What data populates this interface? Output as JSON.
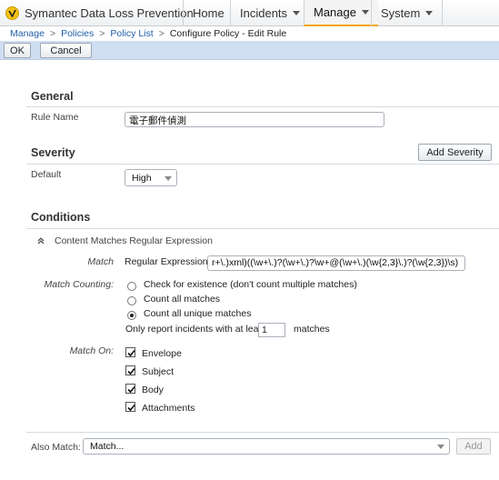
{
  "app": {
    "title": "Symantec Data Loss Prevention"
  },
  "nav": {
    "home": "Home",
    "incidents": "Incidents",
    "manage": "Manage",
    "system": "System"
  },
  "breadcrumb": {
    "manage": "Manage",
    "policies": "Policies",
    "policy_list": "Policy List",
    "current": "Configure Policy - Edit Rule",
    "separator": ">"
  },
  "toolbar": {
    "ok_label": "OK",
    "cancel_label": "Cancel"
  },
  "general": {
    "title": "General",
    "rule_name_label": "Rule Name",
    "rule_name_value": "電子郵件偵測"
  },
  "severity": {
    "title": "Severity",
    "add_severity_label": "Add Severity",
    "default_label": "Default",
    "default_value": "High"
  },
  "conditions": {
    "title": "Conditions",
    "condition_name": "Content Matches Regular Expression",
    "match_label": "Match",
    "regex_label": "Regular Expression:",
    "regex_value": "r+\\.)xml)((\\w+\\.)?(\\w+\\.)?\\w+@(\\w+\\.)(\\w{2,3}\\.)?(\\w{2,3})\\s)",
    "match_counting_label": "Match Counting:",
    "options": [
      {
        "label": "Check for existence (don't count multiple matches)",
        "selected": false
      },
      {
        "label": "Count all matches",
        "selected": false
      },
      {
        "label": "Count all unique matches",
        "selected": true
      }
    ],
    "report_prefix": "Only report incidents with at least",
    "report_value": "1",
    "report_suffix": "matches",
    "match_on_label": "Match On:",
    "match_on": [
      {
        "label": "Envelope",
        "checked": true
      },
      {
        "label": "Subject",
        "checked": true
      },
      {
        "label": "Body",
        "checked": true
      },
      {
        "label": "Attachments",
        "checked": true
      }
    ]
  },
  "also_match": {
    "label": "Also Match:",
    "select_value": "Match...",
    "add_label": "Add"
  }
}
